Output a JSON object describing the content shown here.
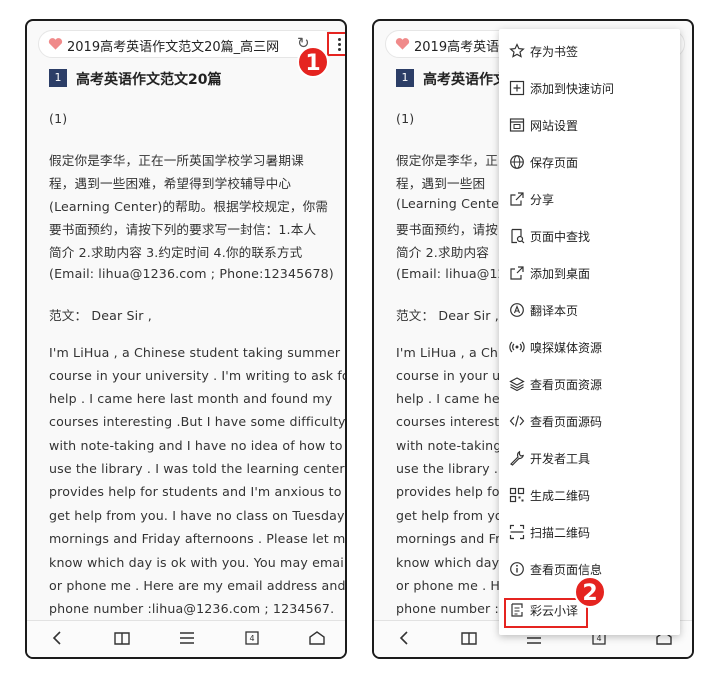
{
  "browser": {
    "tab_title_full": "2019高考英语作文范文20篇_高三网",
    "tab_title_clipped": "2019高考英语作"
  },
  "annotations": {
    "step1": "1",
    "step2": "2",
    "highlight_color": "#e52420"
  },
  "article": {
    "section_number": "1",
    "section_title": "高考英语作文范文20篇",
    "lines": [
      "(1)",
      "假定你是李华，正在一所英国学校学习暑期课",
      "程，遇到一些困难，希望得到学校辅导中心",
      "(Learning Center)的帮助。根据学校规定，你需",
      "要书面预约，请按下列的要求写一封信：1.本人",
      "简介 2.求助内容 3.约定时间 4.你的联系方式",
      "(Email: lihua@1236.com ; Phone:12345678)",
      "范文：  Dear Sir ,",
      "I'm LiHua , a Chinese student taking summer",
      "course in your university . I'm writing to ask for",
      "help . I came here last month and found my",
      "courses interesting .But I have some difficulty",
      "with note-taking and I have no idea of how to",
      "use the library . I was told the learning center",
      "provides help for students and I'm anxious to",
      "get help from you. I have no class on Tuesdays",
      "mornings and Friday afternoons . Please let me",
      "know which day is ok with you. You may email",
      "or phone me . Here are my email address and",
      "phone number :lihua@1236.com ; 1234567."
    ],
    "right_lines": [
      "(1)",
      "假定你是李华，正",
      "程，遇到一些困",
      "(Learning Center)",
      "要书面预约，请按",
      "简介 2.求助内容",
      "(Email: lihua@123",
      "范文：  Dear Sir ,",
      "I'm LiHua , a Chi",
      "course in your un",
      "help . I came her",
      "courses interestir",
      "with note-taking a",
      "use the library . I",
      "provides help for",
      "get help from you",
      "mornings and Fric",
      "know which day i",
      "or phone me . He",
      "phone number :lih"
    ],
    "right_title": "高考英语作文"
  },
  "toolbar": {
    "tab_count": "4"
  },
  "menu": {
    "items": [
      {
        "label": "存为书签",
        "icon": "star-icon"
      },
      {
        "label": "添加到快速访问",
        "icon": "plus-square-icon"
      },
      {
        "label": "网站设置",
        "icon": "site-settings-icon"
      },
      {
        "label": "保存页面",
        "icon": "globe-icon"
      },
      {
        "label": "分享",
        "icon": "share-icon"
      },
      {
        "label": "页面中查找",
        "icon": "find-in-page-icon"
      },
      {
        "label": "添加到桌面",
        "icon": "add-to-desktop-icon"
      },
      {
        "label": "翻译本页",
        "icon": "translate-icon"
      },
      {
        "label": "嗅探媒体资源",
        "icon": "broadcast-icon"
      },
      {
        "label": "查看页面资源",
        "icon": "layers-icon"
      },
      {
        "label": "查看页面源码",
        "icon": "code-icon"
      },
      {
        "label": "开发者工具",
        "icon": "wrench-icon"
      },
      {
        "label": "生成二维码",
        "icon": "qr-code-icon"
      },
      {
        "label": "扫描二维码",
        "icon": "scan-icon"
      },
      {
        "label": "查看页面信息",
        "icon": "info-icon"
      },
      {
        "label": "彩云小译",
        "icon": "translator-app-icon"
      }
    ]
  }
}
